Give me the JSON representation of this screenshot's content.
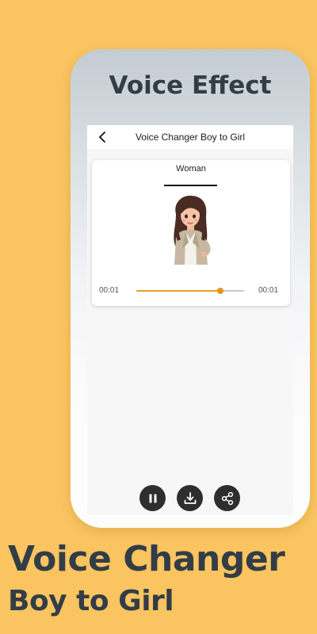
{
  "banner": {
    "phone_title": "Voice Effect",
    "headline": "Voice Changer",
    "subheadline": "Boy to Girl"
  },
  "colors": {
    "background": "#fac560",
    "text_dark": "#333d47",
    "accent": "#e8951b",
    "control_button": "#2e2e2e"
  },
  "app": {
    "title": "Voice Changer Boy to Girl",
    "back_icon": "chevron-left-icon"
  },
  "effect_card": {
    "label": "Woman",
    "image": "woman-avatar",
    "time_current": "00:01",
    "time_total": "00:01",
    "progress": 0.78
  },
  "controls": [
    {
      "name": "pause",
      "icon": "pause-icon"
    },
    {
      "name": "download",
      "icon": "download-icon"
    },
    {
      "name": "share",
      "icon": "share-icon"
    }
  ]
}
